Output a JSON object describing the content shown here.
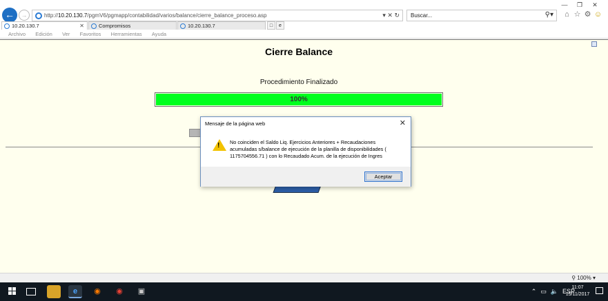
{
  "browser": {
    "url_prefix": "http://",
    "url_host": "10.20.130.7",
    "url_path": "/pgmV6/pgmapp/contabilidad/varios/balance/cierre_balance_proceso.asp",
    "url_buttons": "▾ ✕ ↻",
    "search_placeholder": "Buscar...",
    "tabs": [
      {
        "label": "10.20.130.7"
      },
      {
        "label": "Compromisos"
      },
      {
        "label": "10.20.130.7"
      }
    ],
    "menu": [
      "Archivo",
      "Edición",
      "Ver",
      "Favoritos",
      "Herramientas",
      "Ayuda"
    ],
    "zoom": "100%"
  },
  "page": {
    "title": "Cierre Balance",
    "status_label": "Procedimiento Finalizado",
    "progress_text": "100%",
    "progress_value": 1.0
  },
  "dialog": {
    "title": "Mensaje de la página web",
    "message": "No coinciden el Saldo Liq. Ejercicios Anteriores + Recaudaciones acumuladas s/balance de ejecución de la planilla de disponibilidades ( 1175704556.71 ) con lo Recaudado Acum. de la ejecución de Ingres",
    "ok_label": "Aceptar"
  },
  "taskbar": {
    "language": "ESP",
    "time": "11:07",
    "date": "15/11/2017"
  },
  "colors": {
    "page_background": "#ffffee",
    "progress_fill": "#00ff1e",
    "taskbar": "#101820",
    "warning": "#f2c200"
  }
}
